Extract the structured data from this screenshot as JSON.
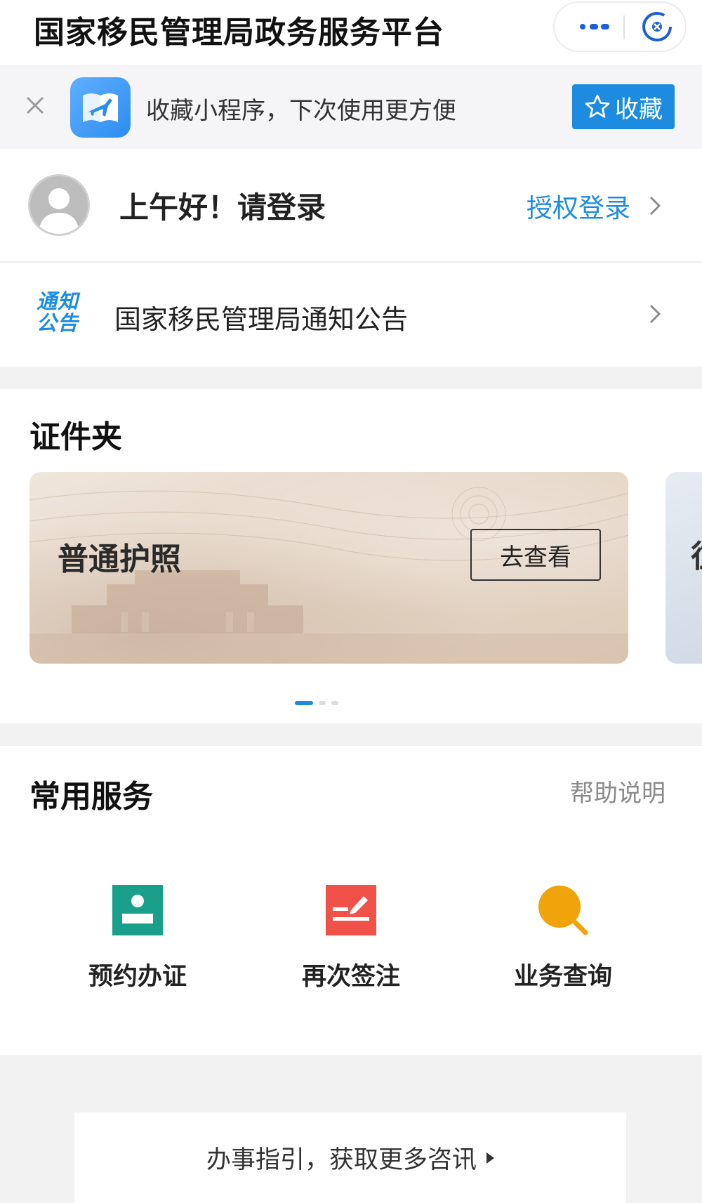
{
  "header": {
    "title": "国家移民管理局政务服务平台",
    "more_icon": "more-dots-icon",
    "close_icon": "mini-program-close-icon"
  },
  "favorite_banner": {
    "text": "收藏小程序，下次使用更方便",
    "button_label": "收藏",
    "close_icon": "close-icon",
    "button_color": "#1d8ce0"
  },
  "login": {
    "greeting": "上午好！请登录",
    "auth_link": "授权登录"
  },
  "notice": {
    "icon_line1": "通知",
    "icon_line2": "公告",
    "text": "国家移民管理局通知公告"
  },
  "cert_folder": {
    "title": "证件夹",
    "cards": [
      {
        "name": "普通护照",
        "button": "去查看"
      },
      {
        "name": "往"
      }
    ],
    "pager": {
      "count": 3,
      "active": 0
    }
  },
  "services": {
    "title": "常用服务",
    "help": "帮助说明",
    "items": [
      {
        "label": "预约办证",
        "icon": "appointment-id-icon",
        "color": "#1aa08a"
      },
      {
        "label": "再次签注",
        "icon": "endorsement-sign-icon",
        "color": "#f0524a"
      },
      {
        "label": "业务查询",
        "icon": "search-magnifier-icon",
        "color": "#f0a30a"
      }
    ]
  },
  "guide": {
    "text": "办事指引，获取更多咨讯"
  },
  "colors": {
    "accent": "#1d8ce0",
    "page_bg": "#f2f2f2"
  }
}
